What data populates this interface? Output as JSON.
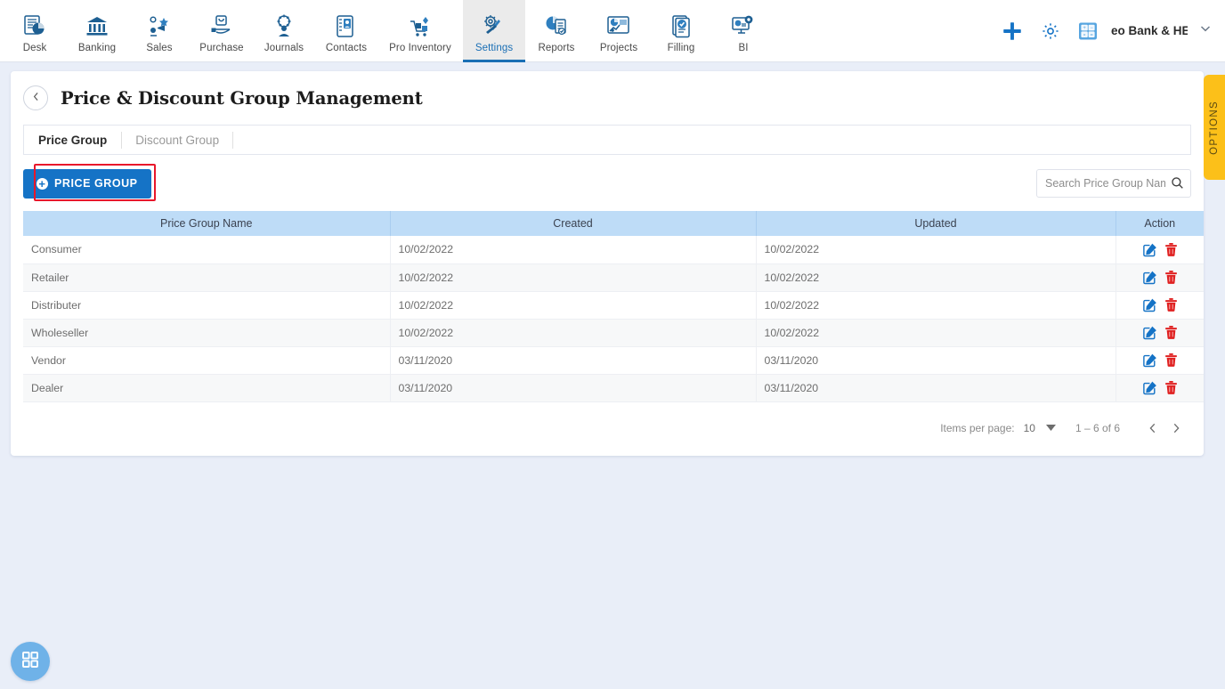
{
  "topnav": {
    "items": [
      {
        "label": "Desk",
        "icon": "dashboard-icon",
        "active": false
      },
      {
        "label": "Banking",
        "icon": "bank-icon",
        "active": false
      },
      {
        "label": "Sales",
        "icon": "sales-icon",
        "active": false
      },
      {
        "label": "Purchase",
        "icon": "purchase-icon",
        "active": false
      },
      {
        "label": "Journals",
        "icon": "journals-icon",
        "active": false
      },
      {
        "label": "Contacts",
        "icon": "contacts-icon",
        "active": false
      },
      {
        "label": "Pro Inventory",
        "icon": "inventory-icon",
        "active": false
      },
      {
        "label": "Settings",
        "icon": "settings-icon",
        "active": true
      },
      {
        "label": "Reports",
        "icon": "reports-icon",
        "active": false
      },
      {
        "label": "Projects",
        "icon": "projects-icon",
        "active": false
      },
      {
        "label": "Filling",
        "icon": "filling-icon",
        "active": false
      },
      {
        "label": "BI",
        "icon": "bi-icon",
        "active": false
      }
    ],
    "add_icon": "plus-icon",
    "settings_icon": "gear-icon",
    "calculator_icon": "calculator-icon",
    "company": "eo Bank & HE",
    "caret_icon": "chevron-down-icon"
  },
  "options_tab": {
    "label": "OPTIONS"
  },
  "page": {
    "back_icon": "chevron-left-icon",
    "title": "Price & Discount Group Management"
  },
  "tabs": [
    {
      "label": "Price Group",
      "active": true
    },
    {
      "label": "Discount Group",
      "active": false
    }
  ],
  "toolbar": {
    "add_button": "PRICE GROUP",
    "add_button_icon": "plus-circle-icon",
    "highlight_color": "#e8172b"
  },
  "search": {
    "placeholder": "Search Price Group Name",
    "value": "",
    "icon": "search-icon"
  },
  "table": {
    "headers": [
      "Price Group Name",
      "Created",
      "Updated",
      "Action"
    ],
    "header_bg": "#bedcf7",
    "rows": [
      {
        "name": "Consumer",
        "created": "10/02/2022",
        "updated": "10/02/2022"
      },
      {
        "name": "Retailer",
        "created": "10/02/2022",
        "updated": "10/02/2022"
      },
      {
        "name": "Distributer",
        "created": "10/02/2022",
        "updated": "10/02/2022"
      },
      {
        "name": "Wholeseller",
        "created": "10/02/2022",
        "updated": "10/02/2022"
      },
      {
        "name": "Vendor",
        "created": "03/11/2020",
        "updated": "03/11/2020"
      },
      {
        "name": "Dealer",
        "created": "03/11/2020",
        "updated": "03/11/2020"
      }
    ],
    "row_actions": {
      "edit_icon": "edit-pencil-icon",
      "edit_color": "#1573c6",
      "delete_icon": "trash-icon",
      "delete_color": "#e02020"
    }
  },
  "paginator": {
    "items_per_page_label": "Items per page:",
    "items_per_page_value": "10",
    "dropdown_icon": "caret-down-icon",
    "range": "1 – 6 of 6",
    "prev_icon": "chevron-left-icon",
    "next_icon": "chevron-right-icon"
  },
  "fab": {
    "icon": "grid-apps-icon",
    "color": "#6fb2e8"
  }
}
